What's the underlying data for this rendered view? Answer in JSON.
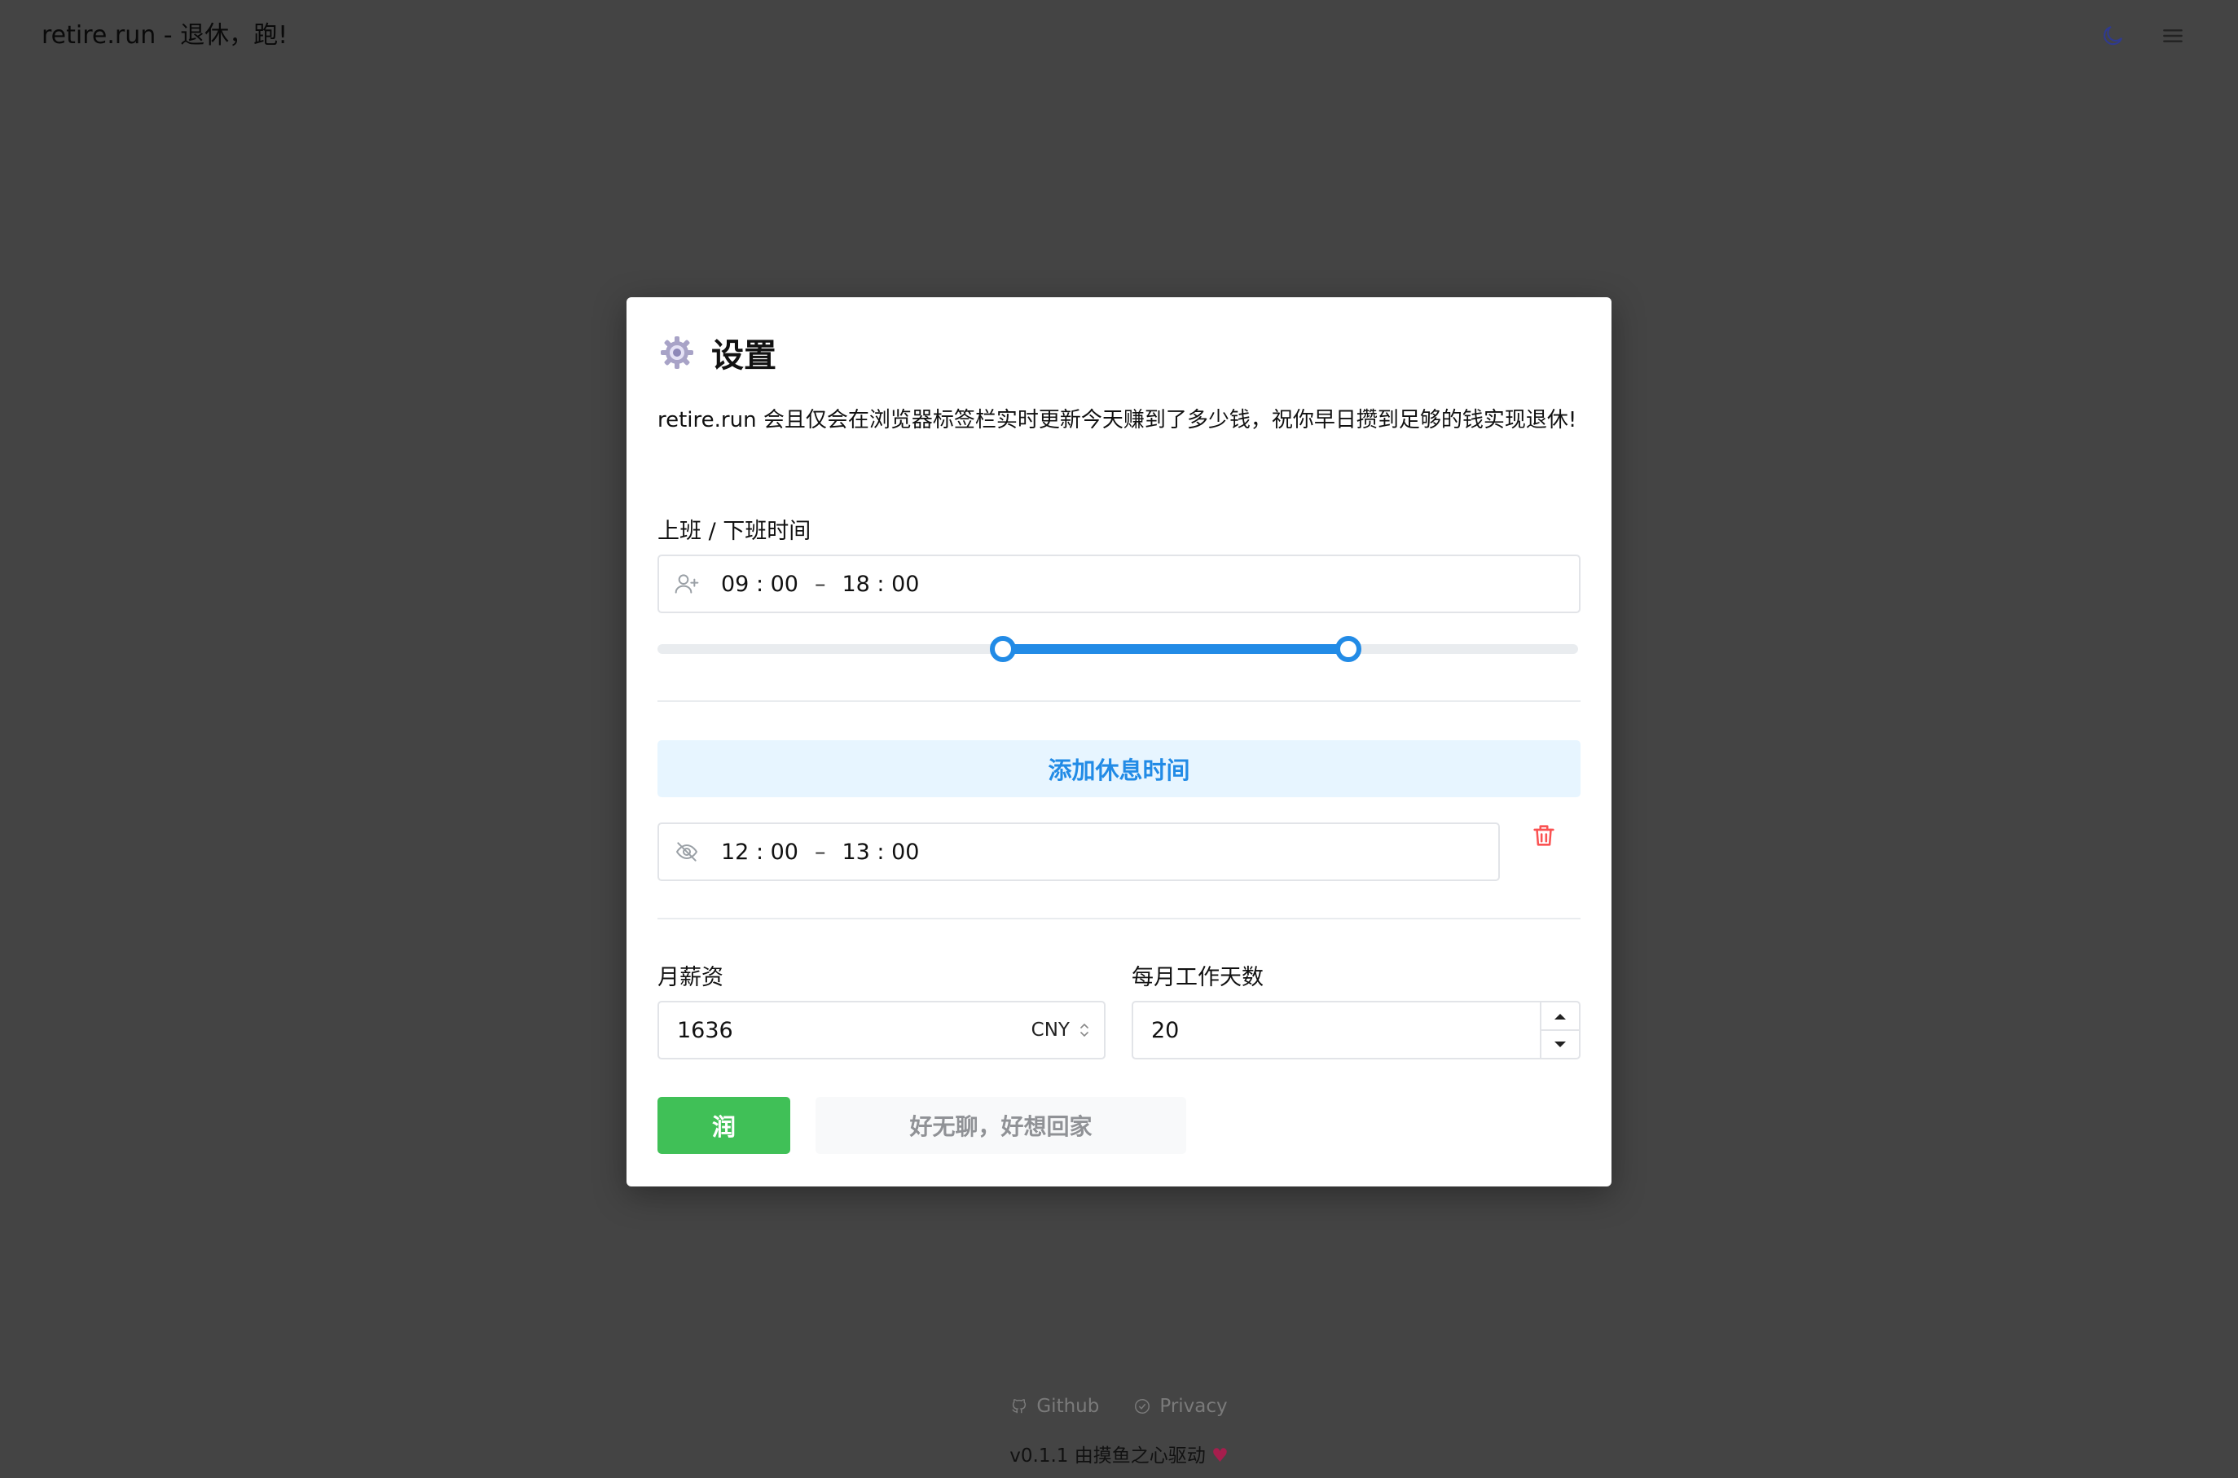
{
  "header": {
    "title": "retire.run - 退休，跑!",
    "theme_icon": "moon-icon",
    "menu_icon": "hamburger-menu-icon"
  },
  "modal": {
    "icon": "gear-icon",
    "title": "设置",
    "description": "retire.run 会且仅会在浏览器标签栏实时更新今天赚到了多少钱，祝你早日攒到足够的钱实现退休!",
    "work_hours": {
      "label": "上班 / 下班时间",
      "icon": "user-plus-icon",
      "start": "09 : 00",
      "separator": "–",
      "end": "18 : 00",
      "slider_range_fraction": [
        0.375,
        0.75
      ]
    },
    "add_break_label": "添加休息时间",
    "break_period": {
      "icon": "eye-off-icon",
      "start": "12 : 00",
      "separator": "–",
      "end": "13 : 00",
      "delete_icon": "trash-icon"
    },
    "salary": {
      "label": "月薪资",
      "value": "1636",
      "currency": "CNY"
    },
    "work_days": {
      "label": "每月工作天数",
      "value": "20"
    },
    "primary_button": "润",
    "secondary_button": "好无聊，好想回家"
  },
  "footer": {
    "github_label": "Github",
    "privacy_label": "Privacy",
    "note": "v0.1.1 由摸鱼之心驱动",
    "heart": "♥"
  },
  "colors": {
    "backdrop": "#444444",
    "accent": "#228be6",
    "success": "#40c057",
    "danger": "#fa5252"
  }
}
